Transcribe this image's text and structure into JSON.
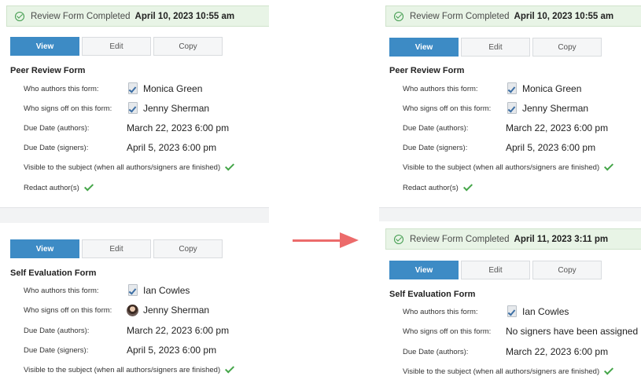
{
  "colors": {
    "primary_button": "#3d8bc5",
    "banner_bg": "#e8f4e6",
    "check_green": "#44a548",
    "arrow": "#ec6b6b"
  },
  "buttons": {
    "view": "View",
    "edit": "Edit",
    "copy": "Copy"
  },
  "labels": {
    "authors": "Who authors this form:",
    "signers": "Who signs off on this form:",
    "due_authors": "Due Date (authors):",
    "due_signers": "Due Date (signers):",
    "visible": "Visible to the subject (when all authors/signers are finished)",
    "redact": "Redact author(s)"
  },
  "left": {
    "banner": {
      "text": "Review Form Completed",
      "date": "April 10, 2023 10:55 am"
    },
    "peer": {
      "title": "Peer Review Form",
      "author": "Monica Green",
      "signer": "Jenny Sherman",
      "due_authors": "March 22, 2023 6:00 pm",
      "due_signers": "April 5, 2023 6:00 pm"
    },
    "self": {
      "title": "Self Evaluation Form",
      "author": "Ian Cowles",
      "signer": "Jenny Sherman",
      "due_authors": "March 22, 2023 6:00 pm",
      "due_signers": "April 5, 2023 6:00 pm"
    }
  },
  "right": {
    "banner": {
      "text": "Review Form Completed",
      "date": "April 10, 2023 10:55 am"
    },
    "peer": {
      "title": "Peer Review Form",
      "author": "Monica Green",
      "signer": "Jenny Sherman",
      "due_authors": "March 22, 2023 6:00 pm",
      "due_signers": "April 5, 2023 6:00 pm"
    },
    "banner2": {
      "text": "Review Form Completed",
      "date": "April 11, 2023 3:11 pm"
    },
    "self": {
      "title": "Self Evaluation Form",
      "author": "Ian Cowles",
      "signer": "No signers have been assigned",
      "due_authors": "March 22, 2023 6:00 pm"
    }
  }
}
